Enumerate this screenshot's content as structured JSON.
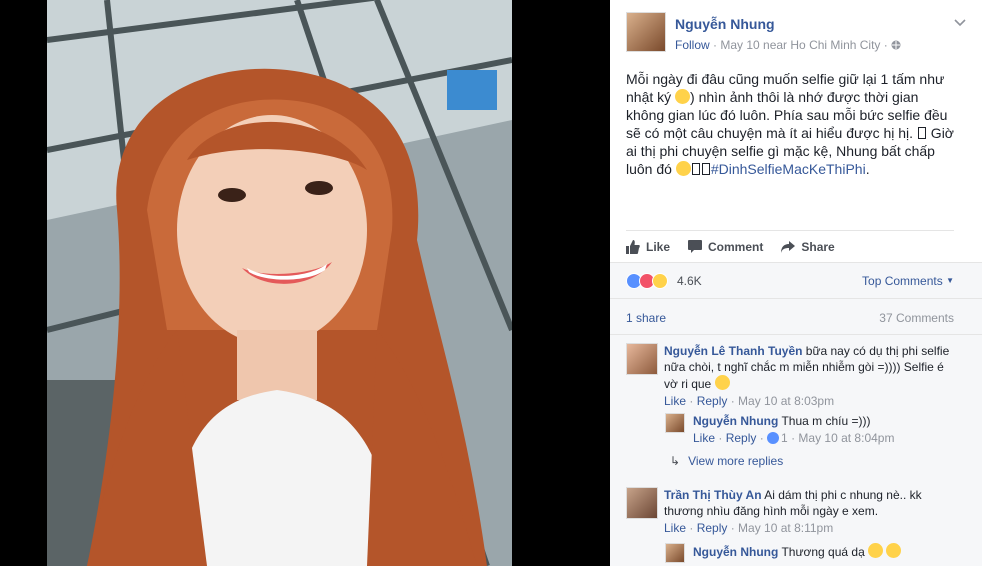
{
  "post": {
    "author": "Nguyễn Nhung",
    "follow": "Follow",
    "meta_rest": " · May 10 near Ho Chi Minh City · ",
    "text_part1": "Mỗi ngày đi đâu cũng muốn selfie giữ lại 1 tấm như nhật ký ",
    "text_part2": ") nhìn ảnh thôi là nhớ được thời gian không gian lúc đó luôn. Phía sau mỗi bức selfie đều sẽ có một câu chuyện mà ít ai hiểu được hị hị. ",
    "text_part3": " Giờ ai thị phi chuyện selfie gì mặc kệ, Nhung bất chấp luôn đó ",
    "hashtag": "#DinhSelfieMacKeThiPhi",
    "text_end": "."
  },
  "actions": {
    "like": "Like",
    "comment": "Comment",
    "share": "Share"
  },
  "reactions": {
    "count": "4.6K",
    "top_comments": "Top Comments"
  },
  "stats": {
    "shares": "1 share",
    "comments": "37 Comments"
  },
  "comments": [
    {
      "name": "Nguyễn Lê Thanh Tuyền",
      "text": " bữa nay có dụ thị phi selfie nữa chòi, t nghĩ chắc m miễn nhiễm gòi =)))) Selfie é vờ ri que ",
      "like": "Like",
      "reply": "Reply",
      "time": "May 10 at 8:03pm"
    },
    {
      "name": "Nguyễn Nhung",
      "text": " Thua m chíu =)))",
      "like": "Like",
      "reply": "Reply",
      "likes": "1",
      "time": "May 10 at 8:04pm"
    },
    {
      "view_more": "View more replies"
    },
    {
      "name": "Trần Thị Thùy An",
      "text": " Ai dám thị phi c nhung nè.. kk thương nhìu đăng hình mỗi ngày e xem.",
      "like": "Like",
      "reply": "Reply",
      "time": "May 10 at 8:11pm"
    },
    {
      "name": "Nguyễn Nhung",
      "text": " Thương quá dạ "
    }
  ],
  "colors": {
    "link": "#365899",
    "meta": "#90949c",
    "like_blue": "#5890ff",
    "love_red": "#f25268",
    "haha_yellow": "#ffd24a"
  },
  "icons": [
    "chevron-down-icon",
    "globe-icon",
    "like-icon",
    "comment-icon",
    "share-icon",
    "reply-arrow-icon"
  ]
}
